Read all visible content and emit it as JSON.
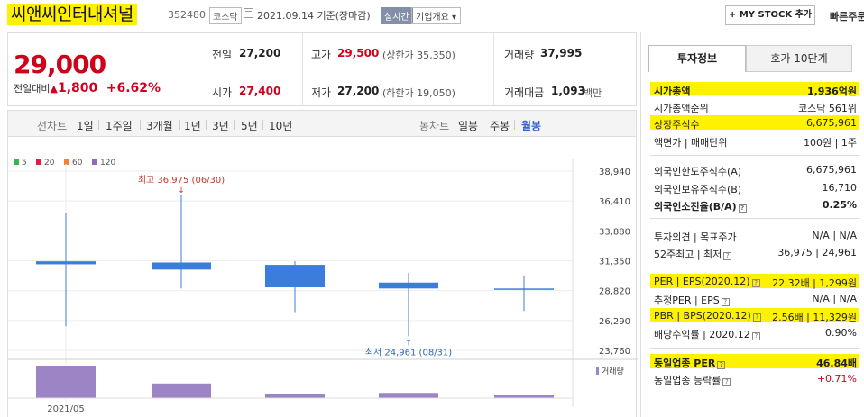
{
  "header": {
    "company_name": "씨앤씨인터내셔널",
    "code": "352480",
    "market": "코스닥",
    "date_text": "2021.09.14 기준(장마감)",
    "realtime": "실시간",
    "overview": "기업개요",
    "mystock_btn": "+ MY STOCK 추가",
    "quick_order": "빠른주문"
  },
  "price_panel": {
    "price": "29,000",
    "change_label": "전일대비",
    "change_amount": "1,800",
    "change_pct": "+6.62%",
    "quotes": {
      "prev_label": "전일",
      "prev_value": "27,200",
      "high_label": "고가",
      "high_value": "29,500",
      "upper_limit": "(상한가 35,350)",
      "volume_label": "거래량",
      "volume_value": "37,995",
      "open_label": "시가",
      "open_value": "27,400",
      "low_label": "저가",
      "low_value": "27,200",
      "lower_limit": "(하한가 19,050)",
      "amount_label": "거래대금",
      "amount_value": "1,093",
      "amount_unit": "백만"
    }
  },
  "tabs": {
    "line_chart": "선차트",
    "periods": [
      "1일",
      "1주일",
      "3개월",
      "1년",
      "3년",
      "5년",
      "10년"
    ],
    "candle_chart": "봉차트",
    "candle_periods": [
      "일봉",
      "주봉",
      "월봉"
    ]
  },
  "chart_data": {
    "type": "candlestick",
    "legend": [
      {
        "label": "5",
        "color": "#3cb44b"
      },
      {
        "label": "20",
        "color": "#e6194b"
      },
      {
        "label": "60",
        "color": "#f58231"
      },
      {
        "label": "120",
        "color": "#9467bd"
      }
    ],
    "y_ticks": [
      23760,
      26290,
      28820,
      31350,
      33880,
      36410,
      38940
    ],
    "y_tick_labels": [
      "23,760",
      "26,290",
      "28,820",
      "31,350",
      "33,880",
      "36,410",
      "38,940"
    ],
    "ylim": [
      23760,
      38940
    ],
    "x_labels": [
      "2021/05"
    ],
    "candles": [
      {
        "open": 31300,
        "close": 31050,
        "high": 35400,
        "low": 25800
      },
      {
        "open": 31200,
        "close": 30600,
        "high": 36975,
        "low": 29000
      },
      {
        "open": 31000,
        "close": 29100,
        "high": 31300,
        "low": 27000
      },
      {
        "open": 29500,
        "close": 29000,
        "high": 30300,
        "low": 24961
      },
      {
        "open": 28900,
        "close": 29000,
        "high": 30100,
        "low": 27100
      }
    ],
    "volumes": [
      1.0,
      0.45,
      0.12,
      0.16,
      0.04
    ],
    "max_annotation": "최고 36,975 (06/30)",
    "min_annotation": "최저 24,961 (08/31)",
    "volume_label": "거래량",
    "candle_color": "#3b7ddd",
    "volume_color": "#9d85c5"
  },
  "info_panel": {
    "tabs": [
      "투자정보",
      "호가 10단계"
    ],
    "market_cap_label": "시가총액",
    "market_cap_value": "1,936억원",
    "market_cap_rank_label": "시가총액순위",
    "market_cap_rank_value": "코스닥 561위",
    "shares_label": "상장주식수",
    "shares_value": "6,675,961",
    "par_label": "액면가 | 매매단위",
    "par_value": "100원 | 1주",
    "foreign_limit_label": "외국인한도주식수(A)",
    "foreign_limit_value": "6,675,961",
    "foreign_hold_label": "외국인보유주식수(B)",
    "foreign_hold_value": "16,710",
    "foreign_ratio_label": "외국인소진율(B/A)",
    "foreign_ratio_value": "0.25%",
    "opinion_label": "투자의견 | 목표주가",
    "opinion_value": "N/A | N/A",
    "week52_label": "52주최고 | 최저",
    "week52_value": "36,975 | 24,961",
    "per_label": "PER | EPS",
    "per_period": "(2020.12)",
    "per_value": "22.32배 | 1,299원",
    "est_per_label": "추정PER | EPS",
    "est_per_value": "N/A | N/A",
    "pbr_label": "PBR | BPS",
    "pbr_period": "(2020.12)",
    "pbr_value": "2.56배 | 11,329원",
    "div_label": "배당수익률 | 2020.12",
    "div_value": "0.90%",
    "sector_per_label": "동일업종 PER",
    "sector_per_value": "46.84배",
    "sector_chg_label": "동일업종 등락률",
    "sector_chg_value": "+0.71%"
  }
}
